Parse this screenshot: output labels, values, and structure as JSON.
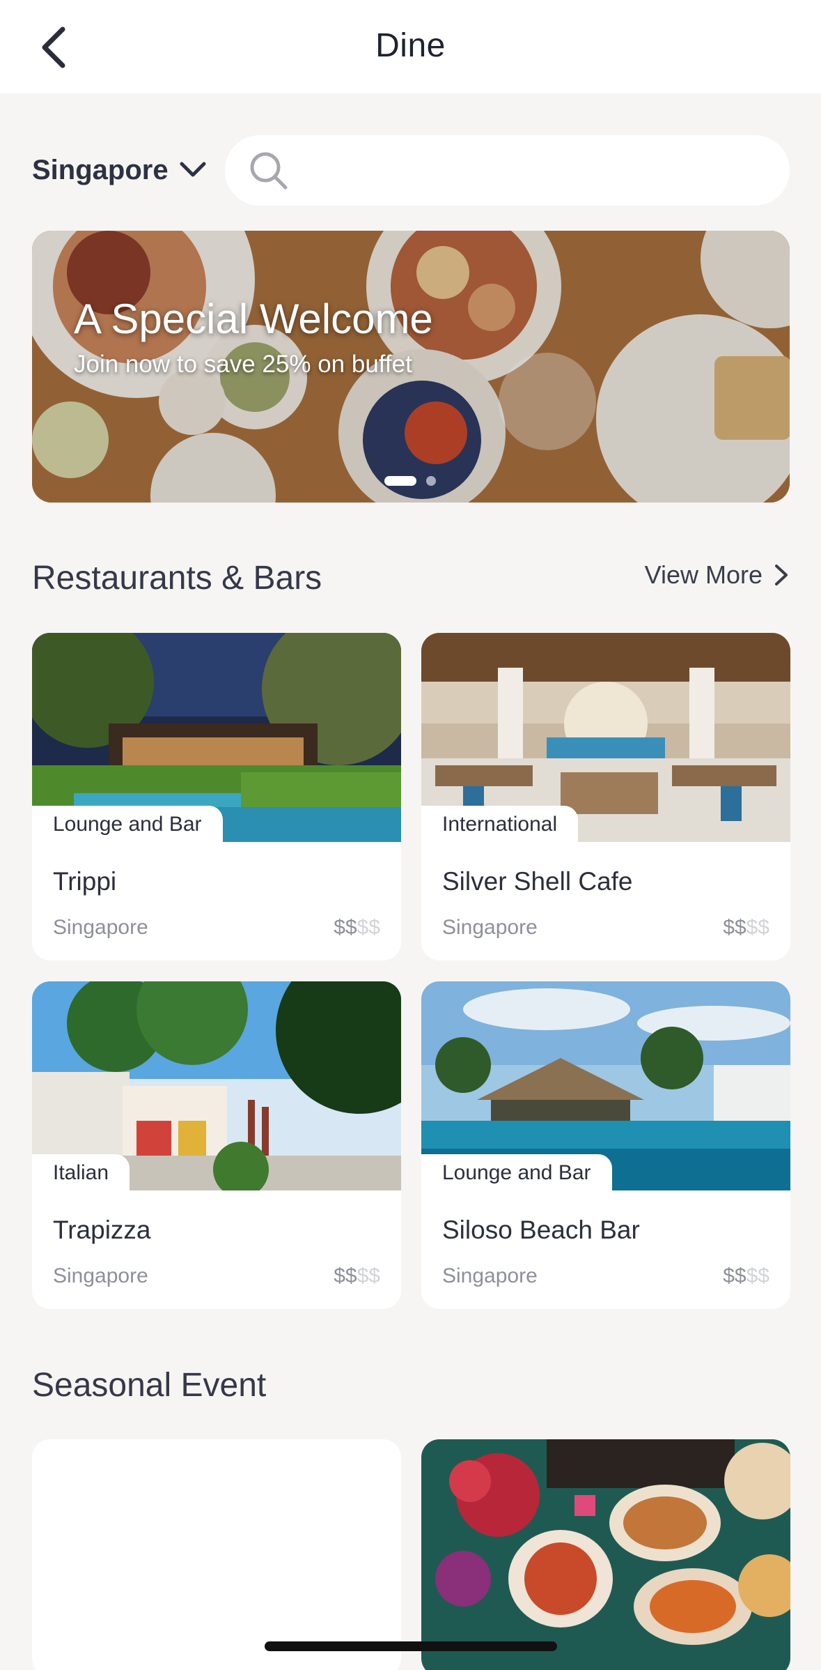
{
  "header": {
    "title": "Dine"
  },
  "location": {
    "selected": "Singapore"
  },
  "search": {
    "placeholder": "",
    "value": ""
  },
  "banner": {
    "title": "A Special Welcome",
    "subtitle": "Join now to save 25% on buffet",
    "slides_count": 2,
    "active_slide": 1
  },
  "restaurants": {
    "title": "Restaurants & Bars",
    "view_more": "View More",
    "items": [
      {
        "tag": "Lounge and Bar",
        "name": "Trippi",
        "location": "Singapore",
        "price_on": "$$",
        "price_off": "$$"
      },
      {
        "tag": "International",
        "name": "Silver Shell Cafe",
        "location": "Singapore",
        "price_on": "$$",
        "price_off": "$$"
      },
      {
        "tag": "Italian",
        "name": "Trapizza",
        "location": "Singapore",
        "price_on": "$$",
        "price_off": "$$"
      },
      {
        "tag": "Lounge and Bar",
        "name": "Siloso Beach Bar",
        "location": "Singapore",
        "price_on": "$$",
        "price_off": "$$"
      }
    ]
  },
  "seasonal": {
    "title": "Seasonal Event"
  },
  "colors": {
    "background": "#f6f5f3",
    "card": "#ffffff",
    "text": "#2c2f3b",
    "muted": "#8e9099"
  },
  "icons": [
    "back-chevron-icon",
    "chevron-down-icon",
    "search-icon",
    "chevron-right-icon"
  ]
}
